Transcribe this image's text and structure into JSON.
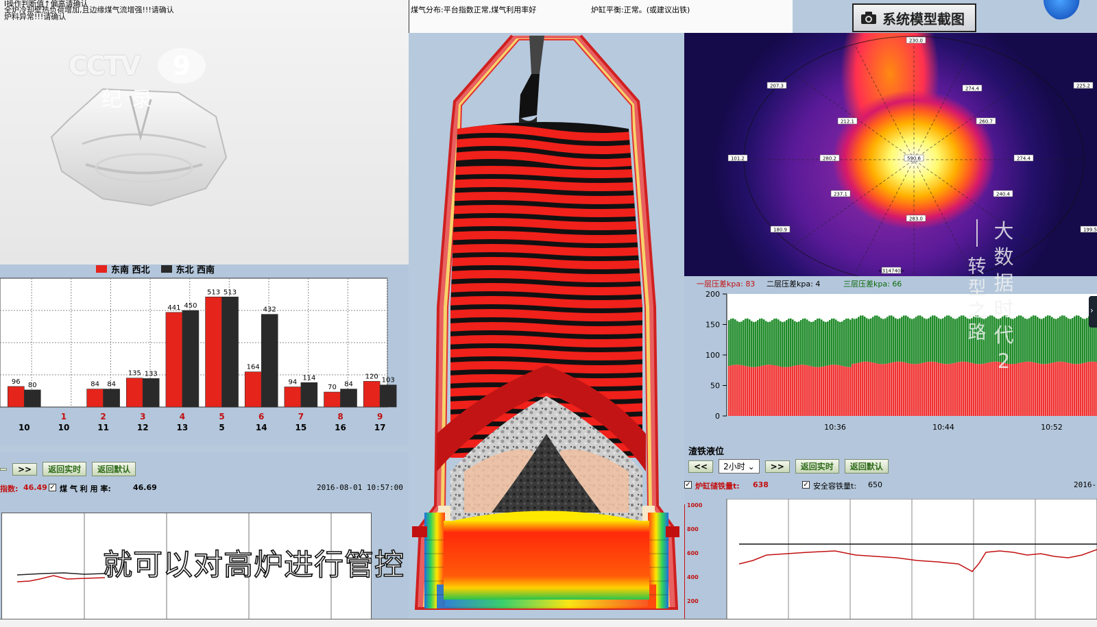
{
  "top_warnings": [
    "Ⅰ操作判断值↑偏高请确认",
    "全炉冷却壁热负荷增加,且边缘煤气流增强!!!请确认",
    "炉料异常!!!请确认"
  ],
  "logo": {
    "brand": "CCTV",
    "channel": "9",
    "sub": "纪录"
  },
  "status_bar": {
    "gas_distribution": "煤气分布:平台指数正常,煤气利用率好",
    "heat_balance": "炉缸平衡:正常。(或建议出铁)"
  },
  "screenshot_button": "系统模型截图",
  "bar_legend": {
    "series1": "东南 西北",
    "series2": "东北 西南",
    "color1": "#e5241b",
    "color2": "#2a2a2a"
  },
  "bar_chart": {
    "chart_data": {
      "type": "bar",
      "ylim": [
        0,
        600
      ],
      "categories_top": [
        "",
        "1",
        "2",
        "3",
        "4",
        "5",
        "6",
        "7",
        "8",
        "9"
      ],
      "categories_bottom": [
        "10",
        "10",
        "11",
        "12",
        "13",
        "5",
        "14",
        "15",
        "16",
        "17"
      ],
      "series": [
        {
          "name": "东南 西北",
          "values": [
            96,
            "",
            84,
            135,
            441,
            513,
            164,
            94,
            70,
            120
          ]
        },
        {
          "name": "东北 西南",
          "values": [
            80,
            "",
            84,
            133,
            450,
            513,
            432,
            114,
            84,
            103
          ]
        }
      ],
      "value_labels_1": [
        "96",
        "",
        "84",
        "135",
        "441",
        "513",
        "164",
        "94",
        "70",
        "120"
      ],
      "value_labels_2": [
        "80",
        "",
        "84",
        "133",
        "450",
        "513",
        "432",
        "114",
        "84",
        "103"
      ]
    }
  },
  "left_controls": {
    "prev": "<<",
    "next": ">>",
    "realtime": "返回实时",
    "default": "返回默认",
    "index_label": "指数:",
    "index_value": "46.49",
    "gas_util_label": "煤 气 利 用 率:",
    "gas_util_value": "46.69",
    "datetime": "2016-08-01 10:57:00"
  },
  "heatmap": {
    "labels": [
      "230.0",
      "207.3",
      "274.4",
      "225.2",
      "212.1",
      "260.7",
      "101.2",
      "280.2",
      "590.6",
      "274.4",
      "237.1",
      "240.4",
      "283.0",
      "180.9",
      "199.5",
      "<314740>"
    ]
  },
  "pressure": {
    "l1": "一层压差kpa:",
    "v1": "83",
    "l2": "二层压差kpa:",
    "v2": "4",
    "l3": "三层压差kpa:",
    "v3": "66"
  },
  "stack_chart": {
    "chart_data": {
      "type": "bar",
      "yticks": [
        "200",
        "150",
        "100",
        "50",
        "0"
      ],
      "ylim": [
        0,
        200
      ],
      "xticks": [
        "10:36",
        "10:44",
        "10:52"
      ],
      "green_level": 160,
      "red_level": 85
    }
  },
  "right_controls": {
    "title": "渣铁液位",
    "prev": "<<",
    "range": "2小时",
    "next": ">>",
    "realtime": "返回实时",
    "default": "返回默认",
    "iron_label": "炉缸储铁量t:",
    "iron_value": "638",
    "safe_label": "安全容铁量t:",
    "safe_value": "650",
    "date": "2016-"
  },
  "line_chart_right": {
    "chart_data": {
      "type": "line",
      "yticks": [
        "1000",
        "800",
        "600",
        "400",
        "200"
      ]
    }
  },
  "subtitle": "就可以对高炉进行管控",
  "watermark": "大数据时代2",
  "watermark_sub": "转型之路"
}
